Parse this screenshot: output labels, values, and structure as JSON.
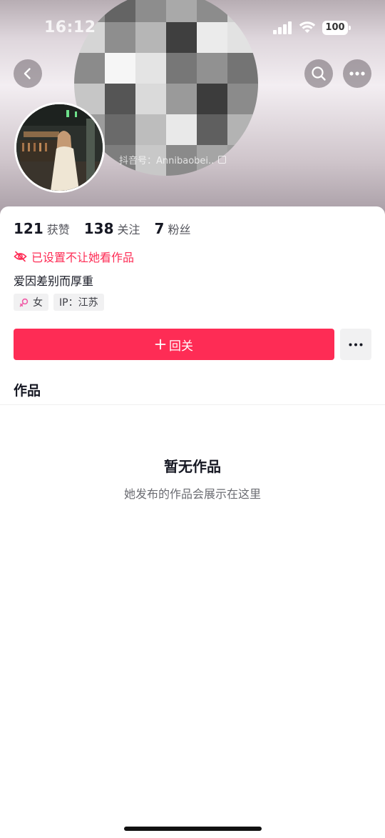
{
  "status_bar": {
    "time": "16:12",
    "battery": "100"
  },
  "profile": {
    "douyin_id": "抖音号：Annibaobei.."
  },
  "stats": [
    {
      "num": "121",
      "label": "获赞"
    },
    {
      "num": "138",
      "label": "关注"
    },
    {
      "num": "7",
      "label": "粉丝"
    }
  ],
  "block_notice": "已设置不让她看作品",
  "bio": "爱因差别而厚重",
  "tags": {
    "gender": "女",
    "ip": "IP：江苏"
  },
  "actions": {
    "follow_back": "回关"
  },
  "tabs": {
    "works": "作品"
  },
  "empty_state": {
    "title": "暂无作品",
    "subtitle": "她发布的作品会展示在这里"
  },
  "colors": {
    "accent": "#fe2c55",
    "tag_bg": "#f1f1f2"
  },
  "icons": [
    "back-icon",
    "search-icon",
    "more-icon",
    "eye-off-icon",
    "female-icon",
    "plus-icon",
    "copy-icon"
  ]
}
